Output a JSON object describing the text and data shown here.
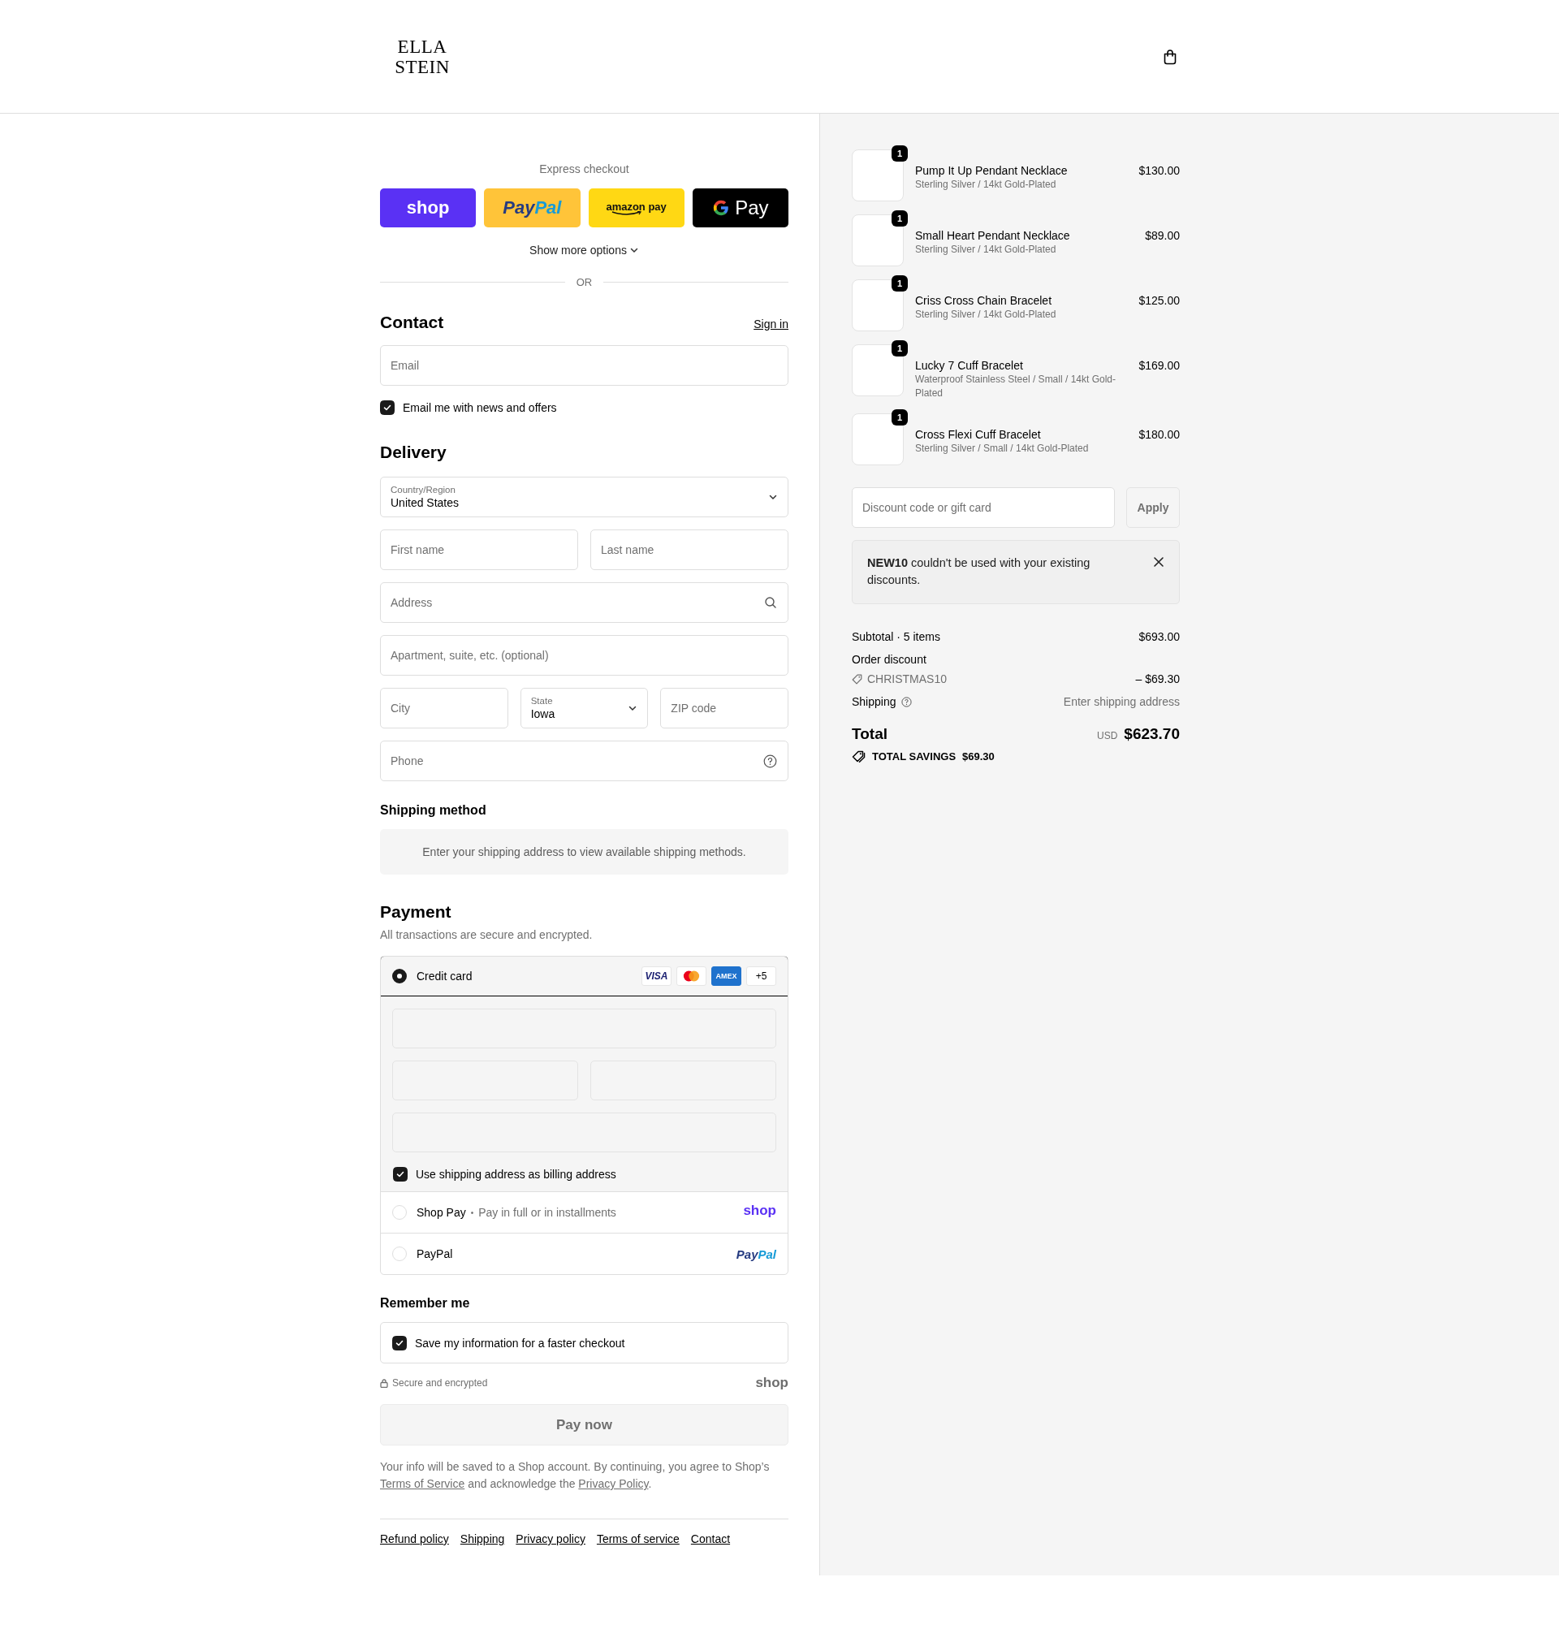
{
  "header": {
    "logo": "ELLA STEIN"
  },
  "express": {
    "label": "Express checkout",
    "buttons": [
      {
        "kind": "shop",
        "label": "shop"
      },
      {
        "kind": "paypal",
        "parts": [
          "Pay",
          "Pal"
        ]
      },
      {
        "kind": "amazon",
        "label": "amazon pay"
      },
      {
        "kind": "gpay",
        "label": "Pay"
      }
    ],
    "more": "Show more options",
    "divider": "OR"
  },
  "contact": {
    "heading": "Contact",
    "sign_in": "Sign in",
    "email": {
      "placeholder": "Email"
    },
    "newsletter": {
      "label": "Email me with news and offers",
      "checked": true
    }
  },
  "delivery": {
    "heading": "Delivery",
    "rows": [
      [
        {
          "kind": "select",
          "label": "Country/Region",
          "value": "United States"
        }
      ],
      [
        {
          "kind": "text",
          "placeholder": "First name"
        },
        {
          "kind": "text",
          "placeholder": "Last name"
        }
      ],
      [
        {
          "kind": "search",
          "placeholder": "Address"
        }
      ],
      [
        {
          "kind": "text",
          "placeholder": "Apartment, suite, etc. (optional)"
        }
      ],
      [
        {
          "kind": "text",
          "placeholder": "City"
        },
        {
          "kind": "select",
          "label": "State",
          "value": "Iowa"
        },
        {
          "kind": "text",
          "placeholder": "ZIP code"
        }
      ],
      [
        {
          "kind": "help",
          "placeholder": "Phone"
        }
      ]
    ]
  },
  "shipping_method": {
    "heading": "Shipping method",
    "message": "Enter your shipping address to view available shipping methods."
  },
  "payment": {
    "heading": "Payment",
    "subtitle": "All transactions are secure and encrypted.",
    "methods": [
      {
        "kind": "card",
        "label": "Credit card",
        "selected": true,
        "badges": [
          {
            "kind": "visa",
            "text": "VISA"
          },
          {
            "kind": "mastercard"
          },
          {
            "kind": "amex",
            "text": "AMEX"
          },
          {
            "kind": "more",
            "text": "+5"
          }
        ],
        "billing": {
          "label": "Use shipping address as billing address",
          "checked": true
        }
      },
      {
        "kind": "shop",
        "label": "Shop Pay",
        "separator": "•",
        "note": "Pay in full or in installments",
        "logo": "shop",
        "selected": false
      },
      {
        "kind": "paypal",
        "label": "PayPal",
        "logo_parts": [
          "Pay",
          "Pal"
        ],
        "selected": false
      }
    ]
  },
  "remember": {
    "heading": "Remember me",
    "option": {
      "label": "Save my information for a faster checkout",
      "checked": true
    },
    "secure": "Secure and encrypted",
    "logo": "shop"
  },
  "pay_button": {
    "label": "Pay now",
    "disabled": true
  },
  "legal": [
    {
      "kind": "text",
      "text": "Your info will be saved to a Shop account. By continuing, you agree to Shop’s "
    },
    {
      "kind": "link",
      "text": "Terms of Service"
    },
    {
      "kind": "text",
      "text": " and acknowledge the "
    },
    {
      "kind": "link",
      "text": "Privacy Policy"
    },
    {
      "kind": "text",
      "text": "."
    }
  ],
  "footer_links": [
    "Refund policy",
    "Shipping",
    "Privacy policy",
    "Terms of service",
    "Contact"
  ],
  "summary": {
    "items": [
      {
        "name": "Pump It Up Pendant Necklace",
        "variant": "Sterling Silver / 14kt Gold-Plated",
        "price": "$130.00",
        "quantity": "1"
      },
      {
        "name": "Small Heart Pendant Necklace",
        "variant": "Sterling Silver / 14kt Gold-Plated",
        "price": "$89.00",
        "quantity": "1"
      },
      {
        "name": "Criss Cross Chain Bracelet",
        "variant": "Sterling Silver / 14kt Gold-Plated",
        "price": "$125.00",
        "quantity": "1"
      },
      {
        "name": "Lucky 7 Cuff Bracelet",
        "variant": "Waterproof Stainless Steel / Small / 14kt Gold-Plated",
        "price": "$169.00",
        "quantity": "1"
      },
      {
        "name": "Cross Flexi Cuff Bracelet",
        "variant": "Sterling Silver / Small / 14kt Gold-Plated",
        "price": "$180.00",
        "quantity": "1"
      }
    ],
    "discount": {
      "placeholder": "Discount code or gift card",
      "button": "Apply"
    },
    "notice": "**NEW10** couldn't be used with your existing discounts.",
    "subtotal": {
      "label": "Subtotal · 5 items",
      "value": "$693.00"
    },
    "order_discount": {
      "label": "Order discount",
      "code": "CHRISTMAS10",
      "value": "– $69.30"
    },
    "shipping": {
      "label": "Shipping",
      "value": "Enter shipping address"
    },
    "total": {
      "label": "Total",
      "currency": "USD",
      "value": "$623.70"
    },
    "savings": {
      "label": "TOTAL SAVINGS",
      "value": "$69.30"
    }
  }
}
